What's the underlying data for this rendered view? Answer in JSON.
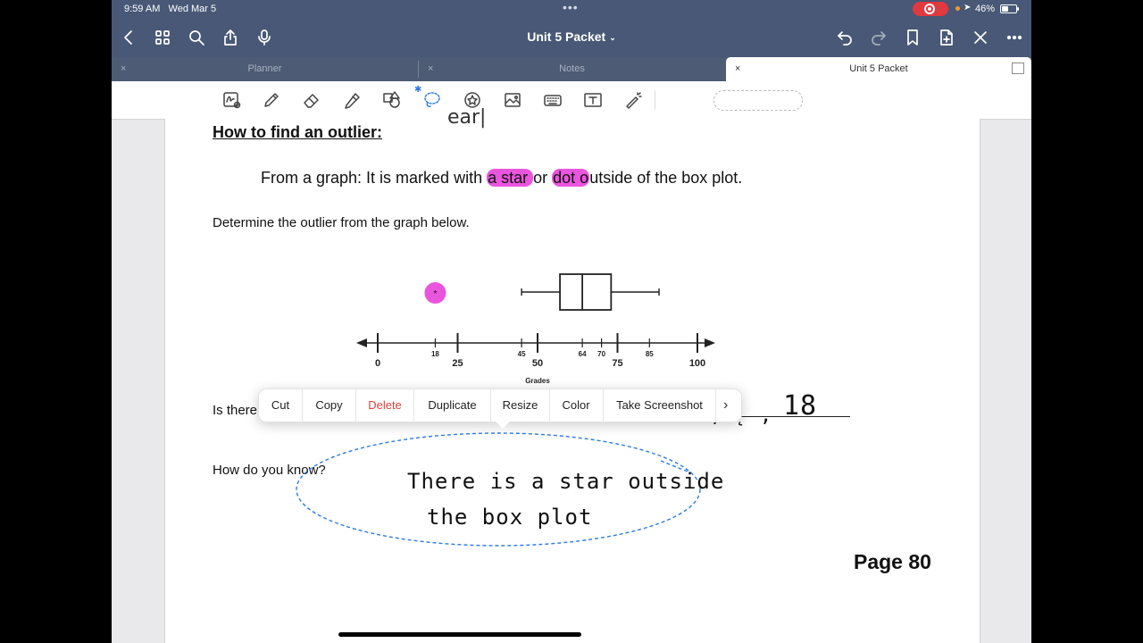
{
  "status_bar": {
    "time": "9:59 AM",
    "date": "Wed Mar 5",
    "battery": "46%"
  },
  "nav": {
    "title": "Unit 5 Packet",
    "icons": [
      "back-icon",
      "grid-icon",
      "search-icon",
      "share-icon",
      "microphone-icon",
      "undo-icon",
      "redo-icon",
      "bookmark-icon",
      "add-page-icon",
      "close-icon",
      "more-icon"
    ]
  },
  "tabs": [
    {
      "label": "Planner",
      "active": false
    },
    {
      "label": "Notes",
      "active": false
    },
    {
      "label": "Unit 5 Packet",
      "active": true
    }
  ],
  "toolbar": {
    "tools": [
      "handwriting-icon",
      "pen-icon",
      "eraser-icon",
      "highlighter-icon",
      "shapes-icon",
      "lasso-icon",
      "sticker-icon",
      "image-icon",
      "keyboard-icon",
      "text-box-icon",
      "laser-pointer-icon"
    ]
  },
  "page": {
    "heading": "How to find an outlier:",
    "line1_prefix": "From a graph:  It is marked with ",
    "line1_hl1": "a star ",
    "line1_mid": "or ",
    "line1_hl2": "dot o",
    "line1_suffix": "utside of the box plot.",
    "line2": "Determine the outlier from the graph below.",
    "question1": "Is there",
    "question2": "How do you know?",
    "page_number": "Page 80",
    "handwriting": {
      "top_fragment": "ear|",
      "answer_value": "18",
      "answer_marks": ", ̨ ,",
      "line1": "There is  a  star outside",
      "line2": "the  box  plot"
    },
    "highlight_color": "#ea55dd"
  },
  "chart_data": {
    "type": "boxplot",
    "xlabel": "Grades",
    "ticks_major": [
      0,
      25,
      50,
      75,
      100
    ],
    "ticks_minor": [
      18,
      45,
      64,
      70,
      85
    ],
    "xlim": [
      0,
      100
    ],
    "box": {
      "whisker_low": 45,
      "q1": 57,
      "median": 64,
      "q3": 73,
      "whisker_high": 88
    },
    "outliers": [
      {
        "value": 18,
        "marker": "star"
      }
    ]
  },
  "context_menu": {
    "items": [
      {
        "label": "Cut",
        "danger": false
      },
      {
        "label": "Copy",
        "danger": false
      },
      {
        "label": "Delete",
        "danger": true
      },
      {
        "label": "Duplicate",
        "danger": false
      },
      {
        "label": "Resize",
        "danger": false
      },
      {
        "label": "Color",
        "danger": false
      },
      {
        "label": "Take Screenshot",
        "danger": false
      }
    ],
    "more": "›"
  }
}
